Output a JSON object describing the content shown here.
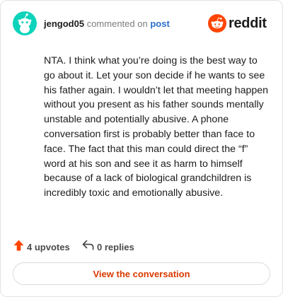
{
  "header": {
    "username": "jengod05",
    "action_text": "commented on",
    "post_link": "post",
    "brand": "reddit"
  },
  "comment": {
    "body": "NTA. I think what you’re doing is the best way to go about it. Let your son decide if he wants to see his father again. I wouldn’t let that meeting happen without you present as his father sounds mentally unstable and potentially abusive. A phone conversation first is probably better than face to face. The fact that this man could direct the “f” word at his son and see it as harm to himself because of a lack of biological grandchildren is incredibly toxic and emotionally abusive."
  },
  "actions": {
    "upvotes": "4 upvotes",
    "replies": "0 replies"
  },
  "cta": {
    "label": "View the conversation"
  },
  "colors": {
    "avatar_bg": "#0dd3bb",
    "reddit_orange": "#ff4500",
    "link_blue": "#2a6fc9",
    "cta_text": "#d93a00"
  },
  "icons": {
    "avatar": "snoo-avatar-icon",
    "brand": "reddit-logo-icon",
    "upvote": "upvote-arrow-icon",
    "reply": "reply-arrow-icon"
  }
}
